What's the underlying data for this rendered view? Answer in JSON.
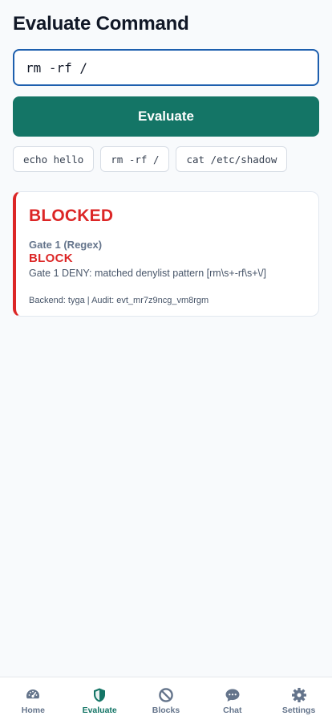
{
  "page": {
    "title": "Evaluate Command"
  },
  "command_input": {
    "value": "rm -rf /"
  },
  "evaluate_button": {
    "label": "Evaluate"
  },
  "examples": [
    "echo hello",
    "rm -rf /",
    "cat /etc/shadow"
  ],
  "result": {
    "verdict": "BLOCKED",
    "gate_name": "Gate 1 (Regex)",
    "gate_result": "BLOCK",
    "gate_detail": "Gate 1 DENY: matched denylist pattern [rm\\s+-rf\\s+\\/]",
    "meta": "Backend: tyga | Audit: evt_mr7z9ncg_vm8rgm"
  },
  "nav": {
    "items": [
      {
        "label": "Home",
        "icon": "gauge-icon"
      },
      {
        "label": "Evaluate",
        "icon": "shield-icon",
        "active": true
      },
      {
        "label": "Blocks",
        "icon": "ban-icon"
      },
      {
        "label": "Chat",
        "icon": "chat-bubble-icon"
      },
      {
        "label": "Settings",
        "icon": "gear-icon"
      }
    ]
  },
  "colors": {
    "accent": "#147566",
    "input_border": "#1d5fae",
    "blocked": "#dc2626"
  }
}
